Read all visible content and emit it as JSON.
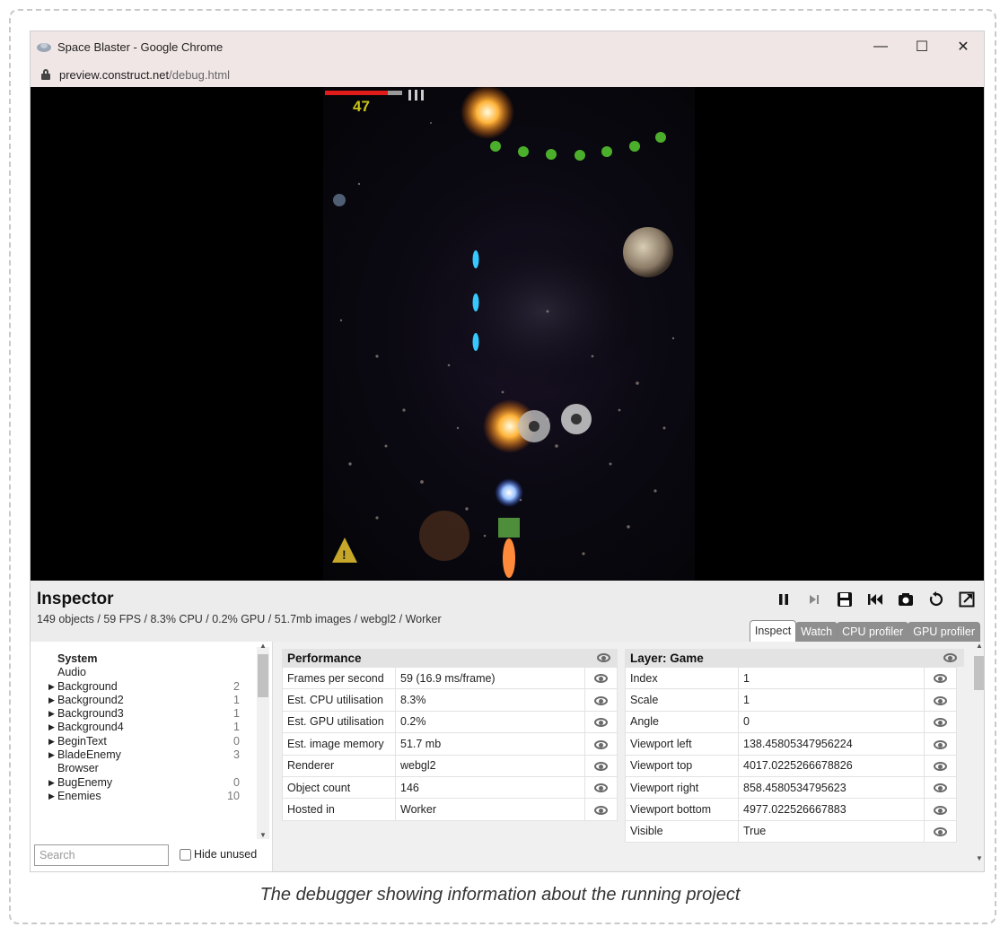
{
  "window": {
    "title": "Space Blaster - Google Chrome",
    "url_domain": "preview.construct.net",
    "url_path": "/debug.html",
    "controls": {
      "minimize": "—",
      "maximize": "☐",
      "close": "✕"
    }
  },
  "game": {
    "score": "47"
  },
  "inspector": {
    "title": "Inspector",
    "stats": "149 objects / 59 FPS / 8.3% CPU / 0.2% GPU / 51.7mb images / webgl2 / Worker",
    "toolbar_icons": [
      "pause-icon",
      "step-icon",
      "save-icon",
      "restore-icon",
      "camera-icon",
      "restart-icon",
      "popout-icon"
    ],
    "tabs": [
      {
        "label": "Inspect",
        "active": true
      },
      {
        "label": "Watch",
        "active": false
      },
      {
        "label": "CPU profiler",
        "active": false
      },
      {
        "label": "GPU profiler",
        "active": false
      }
    ],
    "objects": [
      {
        "name": "System",
        "count": "",
        "expandable": false,
        "bold": true
      },
      {
        "name": "Audio",
        "count": "",
        "expandable": false
      },
      {
        "name": "Background",
        "count": "2",
        "expandable": true
      },
      {
        "name": "Background2",
        "count": "1",
        "expandable": true
      },
      {
        "name": "Background3",
        "count": "1",
        "expandable": true
      },
      {
        "name": "Background4",
        "count": "1",
        "expandable": true
      },
      {
        "name": "BeginText",
        "count": "0",
        "expandable": true
      },
      {
        "name": "BladeEnemy",
        "count": "3",
        "expandable": true
      },
      {
        "name": "Browser",
        "count": "",
        "expandable": false
      },
      {
        "name": "BugEnemy",
        "count": "0",
        "expandable": true
      },
      {
        "name": "Enemies",
        "count": "10",
        "expandable": true
      }
    ],
    "search_placeholder": "Search",
    "hide_unused_label": "Hide unused",
    "performance": {
      "title": "Performance",
      "rows": [
        {
          "label": "Frames per second",
          "value": "59 (16.9 ms/frame)"
        },
        {
          "label": "Est. CPU utilisation",
          "value": "8.3%"
        },
        {
          "label": "Est. GPU utilisation",
          "value": "0.2%"
        },
        {
          "label": "Est. image memory",
          "value": "51.7 mb"
        },
        {
          "label": "Renderer",
          "value": "webgl2"
        },
        {
          "label": "Object count",
          "value": "146"
        },
        {
          "label": "Hosted in",
          "value": "Worker"
        }
      ]
    },
    "layer": {
      "title": "Layer: Game",
      "rows": [
        {
          "label": "Index",
          "value": "1"
        },
        {
          "label": "Scale",
          "value": "1"
        },
        {
          "label": "Angle",
          "value": "0"
        },
        {
          "label": "Viewport left",
          "value": "138.45805347956224"
        },
        {
          "label": "Viewport top",
          "value": "4017.0225266678826"
        },
        {
          "label": "Viewport right",
          "value": "858.4580534795623"
        },
        {
          "label": "Viewport bottom",
          "value": "4977.022526667883"
        },
        {
          "label": "Visible",
          "value": "True"
        }
      ]
    }
  },
  "caption": "The debugger showing information about the running project"
}
